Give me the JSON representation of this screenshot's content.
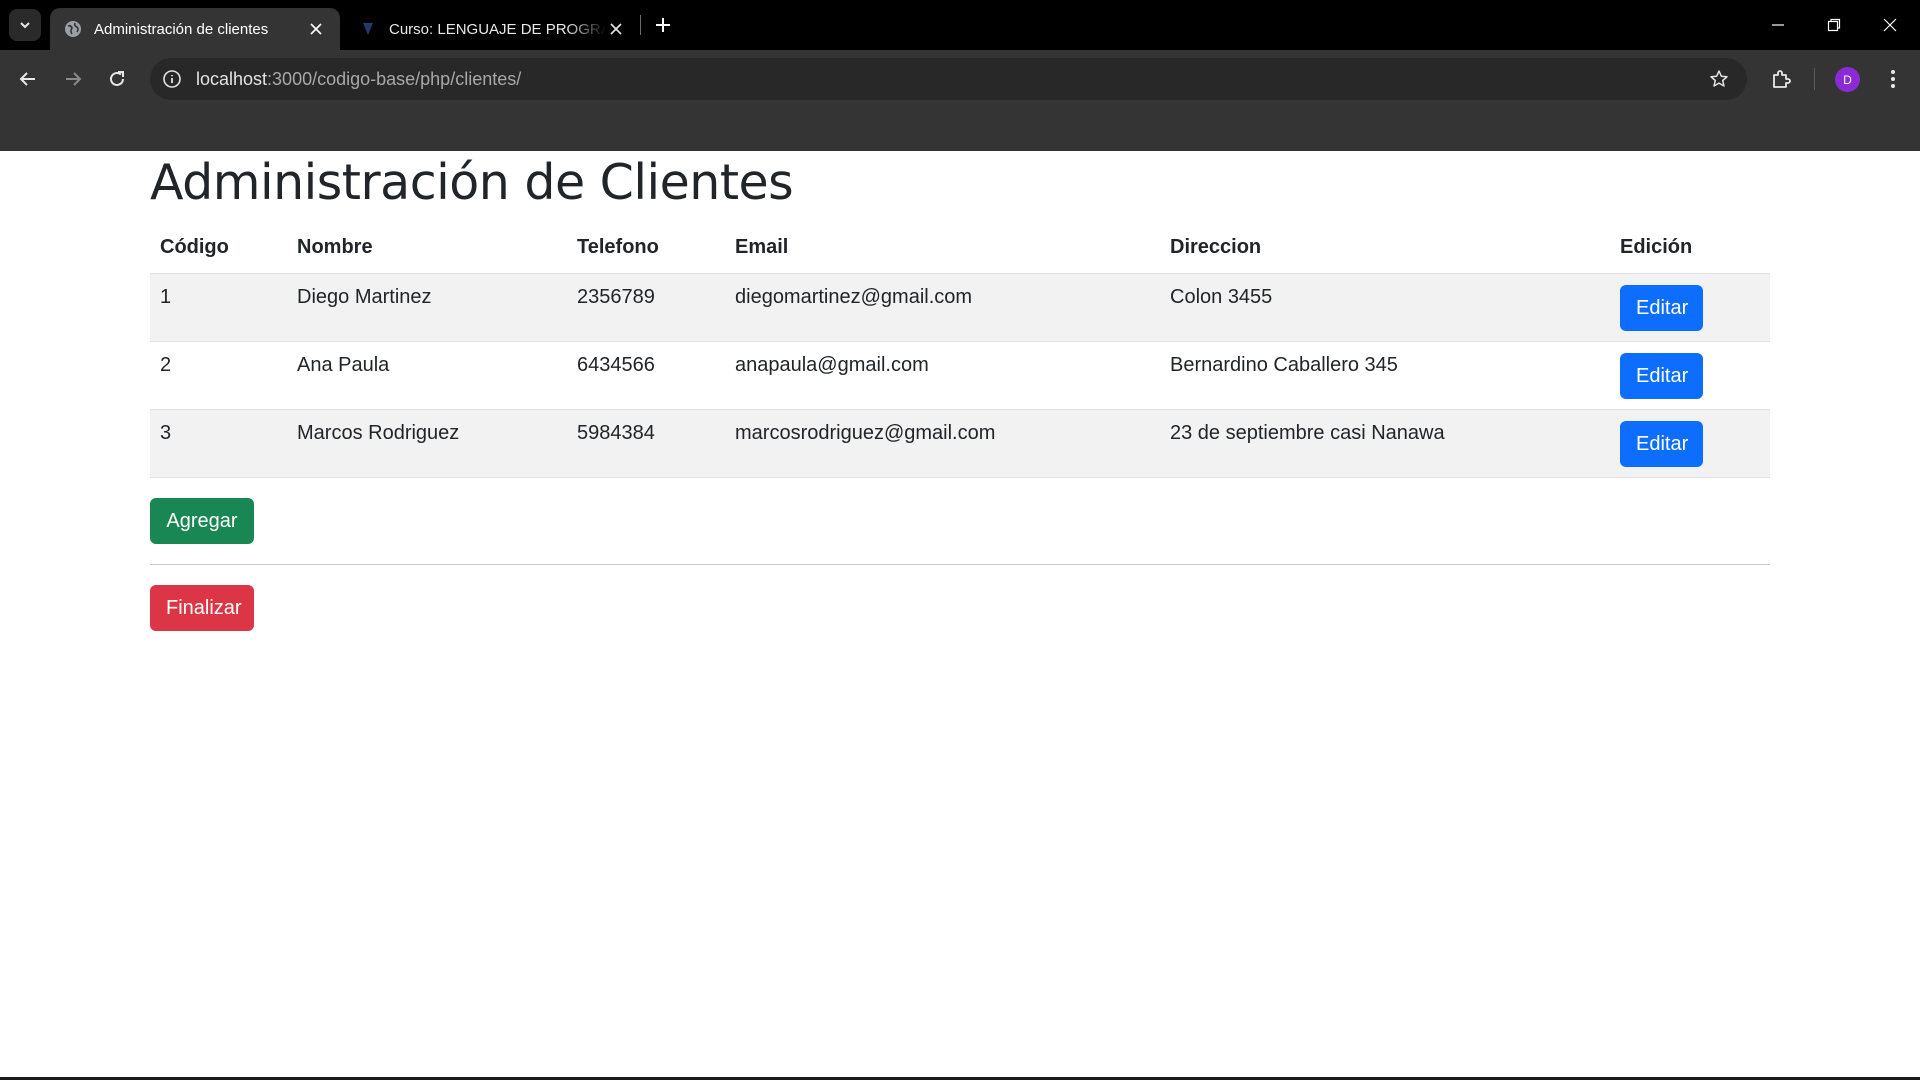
{
  "browser": {
    "tabs": [
      {
        "title": "Administración de clientes",
        "active": true
      },
      {
        "title": "Curso: LENGUAJE DE PROGRAMACIÓN",
        "active": false
      }
    ],
    "url_host": "localhost",
    "url_rest": ":3000/codigo-base/php/clientes/",
    "profile_initial": "D",
    "icons": [
      "tab-search-icon",
      "globe-icon",
      "close-icon",
      "plus-icon",
      "minimize-icon",
      "restore-icon",
      "back-icon",
      "forward-icon",
      "reload-icon",
      "info-icon",
      "star-icon",
      "extensions-icon",
      "kebab-menu-icon"
    ]
  },
  "page": {
    "title": "Administración de Clientes",
    "columns": [
      "Código",
      "Nombre",
      "Telefono",
      "Email",
      "Direccion",
      "Edición"
    ],
    "rows": [
      {
        "codigo": "1",
        "nombre": "Diego Martinez",
        "telefono": "2356789",
        "email": "diegomartinez@gmail.com",
        "direccion": "Colon 3455",
        "action": "Editar"
      },
      {
        "codigo": "2",
        "nombre": "Ana Paula",
        "telefono": "6434566",
        "email": "anapaula@gmail.com",
        "direccion": "Bernardino Caballero 345",
        "action": "Editar"
      },
      {
        "codigo": "3",
        "nombre": "Marcos Rodriguez",
        "telefono": "5984384",
        "email": "marcosrodriguez@gmail.com",
        "direccion": "23 de septiembre casi Nanawa",
        "action": "Editar"
      }
    ],
    "add_button": "Agregar",
    "finish_button": "Finalizar"
  },
  "colors": {
    "primary": "#0d6efd",
    "success": "#198754",
    "danger": "#dc3545",
    "text": "#212529",
    "striped_row": "#f2f2f2"
  }
}
